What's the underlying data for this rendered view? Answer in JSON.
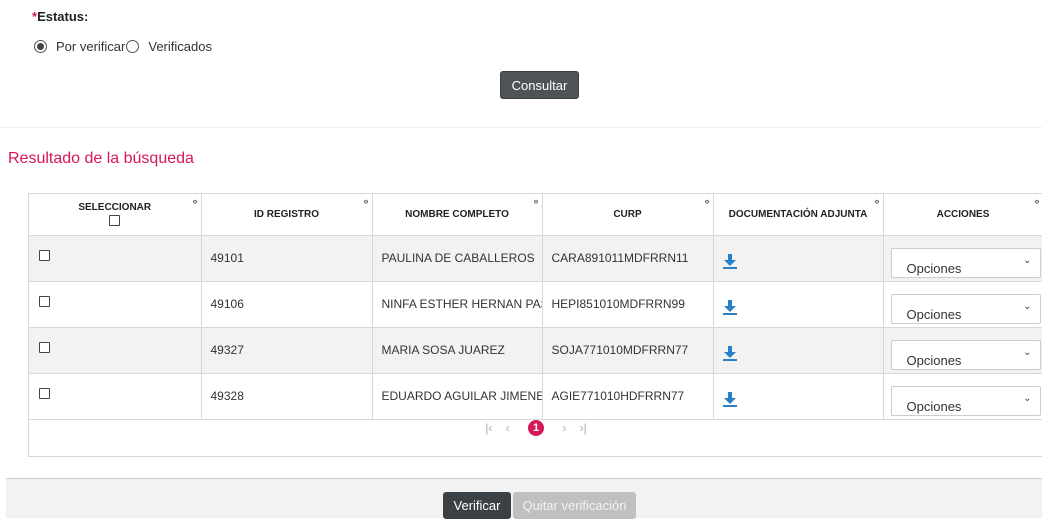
{
  "filters": {
    "required_mark": "*",
    "status_label": "Estatus:",
    "options": [
      {
        "label": "Por verificar",
        "checked": true
      },
      {
        "label": "Verificados",
        "checked": false
      }
    ],
    "consult_label": "Consultar"
  },
  "results": {
    "title": "Resultado de la búsqueda",
    "columns": [
      "SELECCIONAR",
      "ID REGISTRO",
      "NOMBRE COMPLETO",
      "CURP",
      "DOCUMENTACIÓN ADJUNTA",
      "ACCIONES"
    ],
    "resize_glyph": "‹›",
    "rows": [
      {
        "id": "49101",
        "name": "PAULINA DE CABALLEROS",
        "curp": "CARA891011MDFRRN11",
        "action": "Opciones"
      },
      {
        "id": "49106",
        "name": "NINFA ESTHER HERNAN PAS",
        "curp": "HEPI851010MDFRRN99",
        "action": "Opciones"
      },
      {
        "id": "49327",
        "name": "MARIA SOSA JUAREZ",
        "curp": "SOJA771010MDFRRN77",
        "action": "Opciones"
      },
      {
        "id": "49328",
        "name": "EDUARDO AGUILAR JIMENEZ",
        "curp": "AGIE771010HDFRRN77",
        "action": "Opciones"
      }
    ],
    "icons": {
      "download": "download-icon",
      "checkbox": "checkbox-icon",
      "chevron": "chevron-down-icon"
    }
  },
  "pagination": {
    "first": "|‹",
    "prev": "‹",
    "current": "1",
    "next": "›",
    "last": "›|"
  },
  "footer": {
    "verify_label": "Verificar",
    "unverify_label": "Quitar verificación"
  },
  "colors": {
    "accent": "#d6185b",
    "button_dark": "#4d5356",
    "button_disabled": "#bfc0c1",
    "download_icon": "#2a7fc9"
  }
}
